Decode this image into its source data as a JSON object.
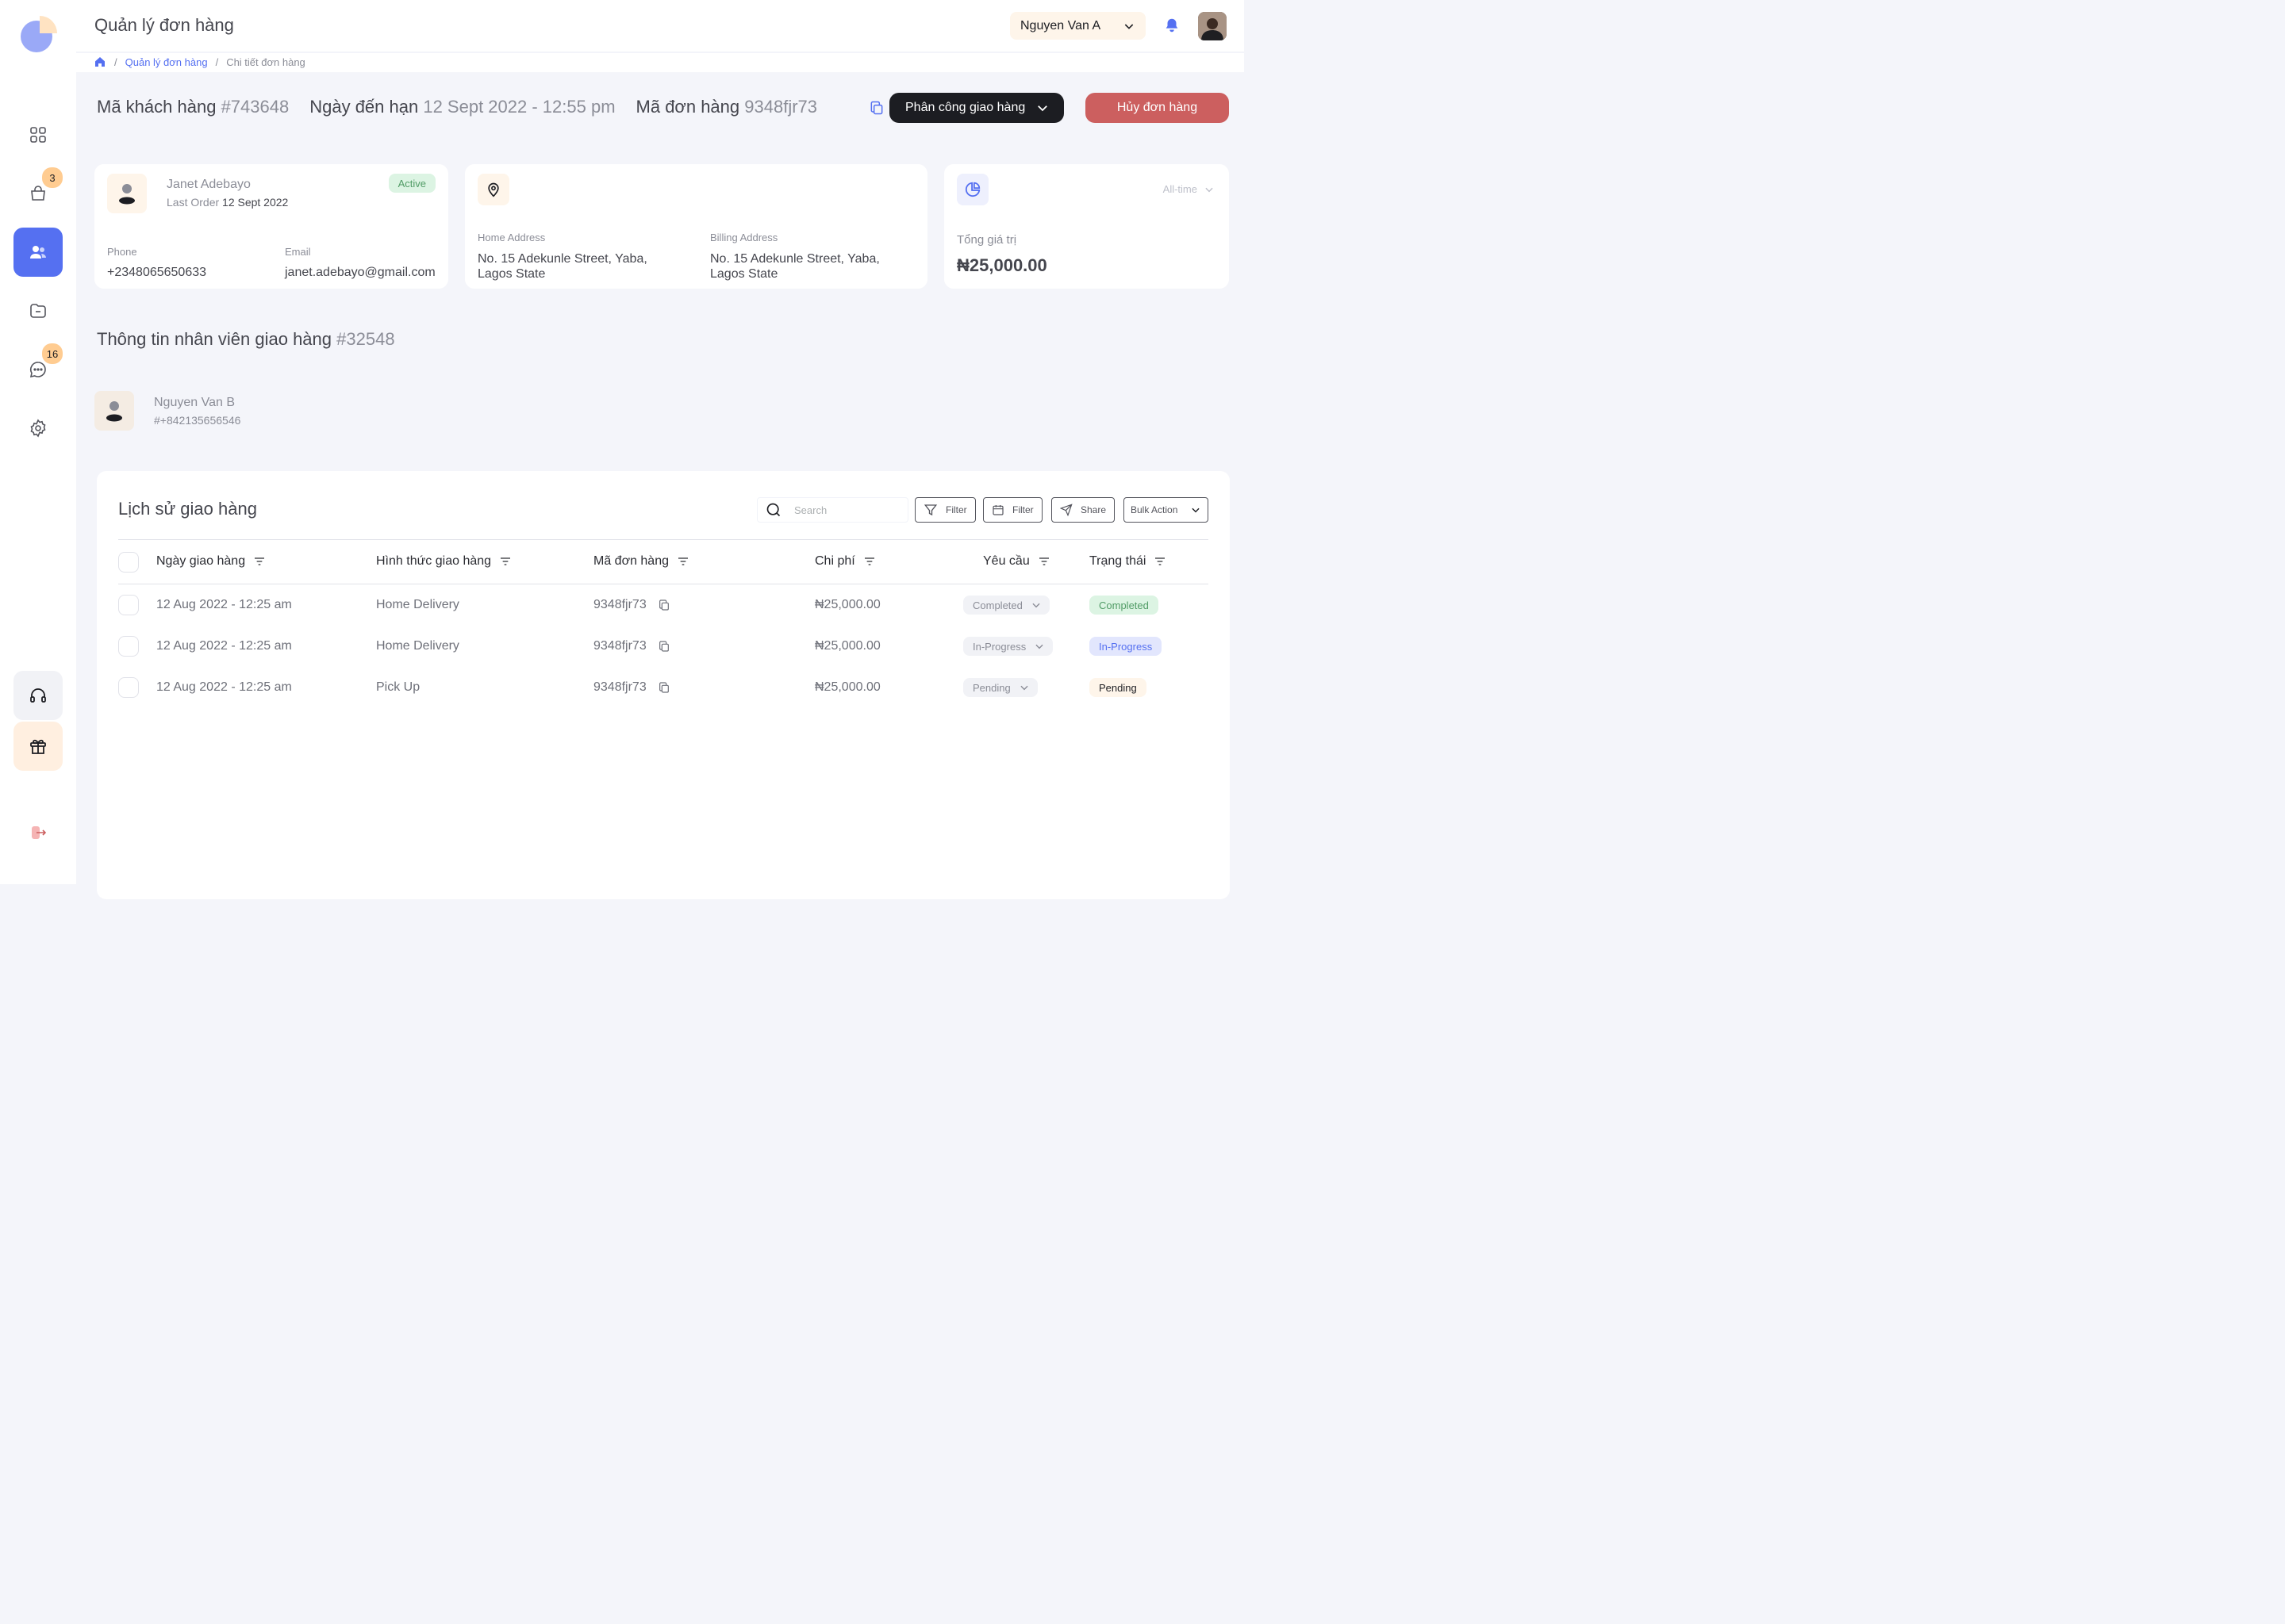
{
  "header": {
    "title": "Quản lý đơn hàng",
    "user_name": "Nguyen Van A"
  },
  "breadcrumb": {
    "items": [
      "Quản lý đơn hàng",
      "Chi tiết đơn hàng"
    ],
    "separator": "/"
  },
  "sidebar": {
    "items": [
      {
        "icon": "dashboard-icon"
      },
      {
        "icon": "shopping-bag-icon",
        "badge": "3"
      },
      {
        "icon": "customers-icon",
        "active": true
      },
      {
        "icon": "folder-icon"
      },
      {
        "icon": "chat-icon",
        "badge": "16"
      },
      {
        "icon": "settings-icon"
      }
    ],
    "bottom": [
      "headphones-icon",
      "gift-icon",
      "logout-icon"
    ]
  },
  "order_info": {
    "customer_label": "Mã khách hàng",
    "customer_id": "#743648",
    "due_label": "Ngày đến hạn",
    "due_value": "12 Sept 2022 - 12:55 pm",
    "order_label": "Mã đơn hàng",
    "order_id": "9348fjr73",
    "assign_button": "Phân công giao hàng",
    "cancel_button": "Hủy đơn hàng"
  },
  "customer_card": {
    "name": "Janet Adebayo",
    "last_order_label": "Last Order",
    "last_order_value": "12 Sept 2022",
    "status": "Active",
    "phone_label": "Phone",
    "phone": "+2348065650633",
    "email_label": "Email",
    "email": "janet.adebayo@gmail.com"
  },
  "address_card": {
    "home_label": "Home Address",
    "home_line1": "No. 15 Adekunle Street, Yaba,",
    "home_line2": "Lagos State",
    "billing_label": "Billing Address",
    "billing_line1": "No. 15 Adekunle Street, Yaba,",
    "billing_line2": "Lagos State"
  },
  "total_card": {
    "period": "All-time",
    "label": "Tổng giá trị",
    "value": "₦25,000.00"
  },
  "courier": {
    "title": "Thông tin nhân viên giao hàng",
    "id": "#32548",
    "name": "Nguyen Van B",
    "phone": "#+842135656546"
  },
  "history": {
    "title": "Lịch sử giao hàng",
    "search_placeholder": "Search",
    "filter_label": "Filter",
    "date_filter_label": "Filter",
    "share_label": "Share",
    "bulk_label": "Bulk Action",
    "columns": [
      "Ngày giao hàng",
      "Hình thức giao hàng",
      "Mã đơn hàng",
      "Chi phí",
      "Yêu cầu",
      "Trạng thái"
    ],
    "rows": [
      {
        "date": "12 Aug 2022 - 12:25 am",
        "method": "Home Delivery",
        "order": "9348fjr73",
        "cost": "₦25,000.00",
        "request": "Completed",
        "status": "Completed"
      },
      {
        "date": "12 Aug 2022 - 12:25 am",
        "method": "Home Delivery",
        "order": "9348fjr73",
        "cost": "₦25,000.00",
        "request": "In-Progress",
        "status": "In-Progress"
      },
      {
        "date": "12 Aug 2022 - 12:25 am",
        "method": "Pick Up",
        "order": "9348fjr73",
        "cost": "₦25,000.00",
        "request": "Pending",
        "status": "Pending"
      }
    ]
  },
  "colors": {
    "primary": "#5570f1",
    "danger": "#cc5f5f",
    "dark": "#1c1d22",
    "accent_soft": "#fef5ea",
    "badge": "#ffcc91",
    "completed_bg": "#dcf4e3",
    "completed_text": "#519c66",
    "progress_bg": "#e2e6fd",
    "progress_text": "#5570f1",
    "pending_bg": "#fef5ea",
    "pending_text": "#1c1d22"
  }
}
